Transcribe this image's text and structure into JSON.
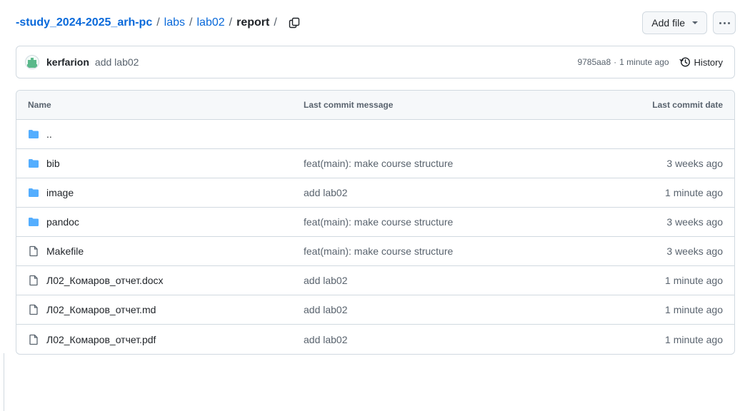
{
  "breadcrumb": {
    "repo": "-study_2024-2025_arh-pc",
    "segments": [
      "labs",
      "lab02"
    ],
    "current": "report",
    "separator": "/"
  },
  "actions": {
    "add_file_label": "Add file",
    "more_icon": "kebab-horizontal-icon"
  },
  "commit": {
    "author": "kerfarion",
    "message": "add lab02",
    "sha": "9785aa8",
    "separator": "·",
    "time": "1 minute ago",
    "history_label": "History"
  },
  "table": {
    "headers": {
      "name": "Name",
      "message": "Last commit message",
      "date": "Last commit date"
    },
    "parent": "..",
    "rows": [
      {
        "name": "bib",
        "type": "folder",
        "message": "feat(main): make course structure",
        "date": "3 weeks ago"
      },
      {
        "name": "image",
        "type": "folder",
        "message": "add lab02",
        "date": "1 minute ago"
      },
      {
        "name": "pandoc",
        "type": "folder",
        "message": "feat(main): make course structure",
        "date": "3 weeks ago"
      },
      {
        "name": "Makefile",
        "type": "file",
        "message": "feat(main): make course structure",
        "date": "3 weeks ago"
      },
      {
        "name": "Л02_Комаров_отчет.docx",
        "type": "file",
        "message": "add lab02",
        "date": "1 minute ago"
      },
      {
        "name": "Л02_Комаров_отчет.md",
        "type": "file",
        "message": "add lab02",
        "date": "1 minute ago"
      },
      {
        "name": "Л02_Комаров_отчет.pdf",
        "type": "file",
        "message": "add lab02",
        "date": "1 minute ago"
      }
    ]
  },
  "colors": {
    "link": "#0969da",
    "folder": "#54aeff",
    "muted": "#59636e",
    "border": "#d1d9e0"
  }
}
